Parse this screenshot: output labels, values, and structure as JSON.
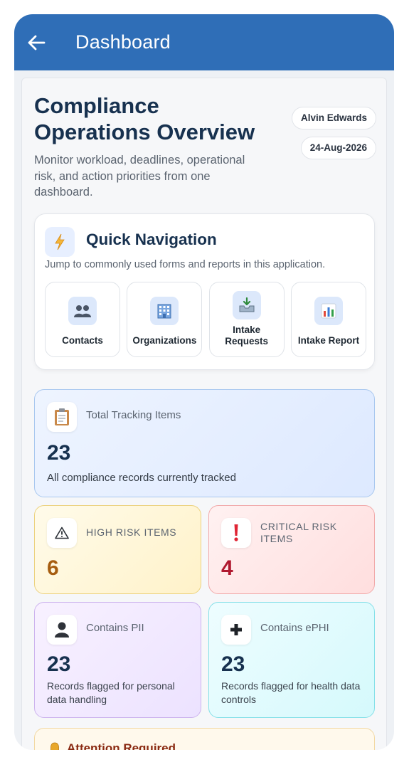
{
  "appbar": {
    "title": "Dashboard"
  },
  "header": {
    "title": "Compliance Operations Overview",
    "description": "Monitor workload, deadlines, operational risk, and action priorities from one dashboard.",
    "user": "Alvin Edwards",
    "date": "24-Aug-2026"
  },
  "quick_nav": {
    "title": "Quick Navigation",
    "subtitle": "Jump to commonly used forms and reports in this application.",
    "items": [
      {
        "label": "Contacts",
        "icon": "contacts-icon"
      },
      {
        "label": "Organizations",
        "icon": "building-icon"
      },
      {
        "label": "Intake Requests",
        "icon": "inbox-tray-icon"
      },
      {
        "label": "Intake Report",
        "icon": "bar-chart-icon"
      }
    ]
  },
  "metrics": {
    "total": {
      "label": "Total Tracking Items",
      "value": "23",
      "description": "All compliance records currently tracked"
    },
    "high_risk": {
      "label": "HIGH RISK ITEMS",
      "value": "6",
      "color": "#a65d10"
    },
    "critical_risk": {
      "label": "CRITICAL RISK ITEMS",
      "value": "4",
      "color": "#b0182f"
    },
    "pii": {
      "label": "Contains PII",
      "value": "23",
      "description": "Records flagged for personal data handling"
    },
    "ephi": {
      "label": "Contains ePHI",
      "value": "23",
      "description": "Records flagged for health data controls"
    }
  },
  "attention": {
    "title": "Attention Required"
  },
  "colors": {
    "appbar": "#2f6eb7",
    "title": "#17314f"
  }
}
